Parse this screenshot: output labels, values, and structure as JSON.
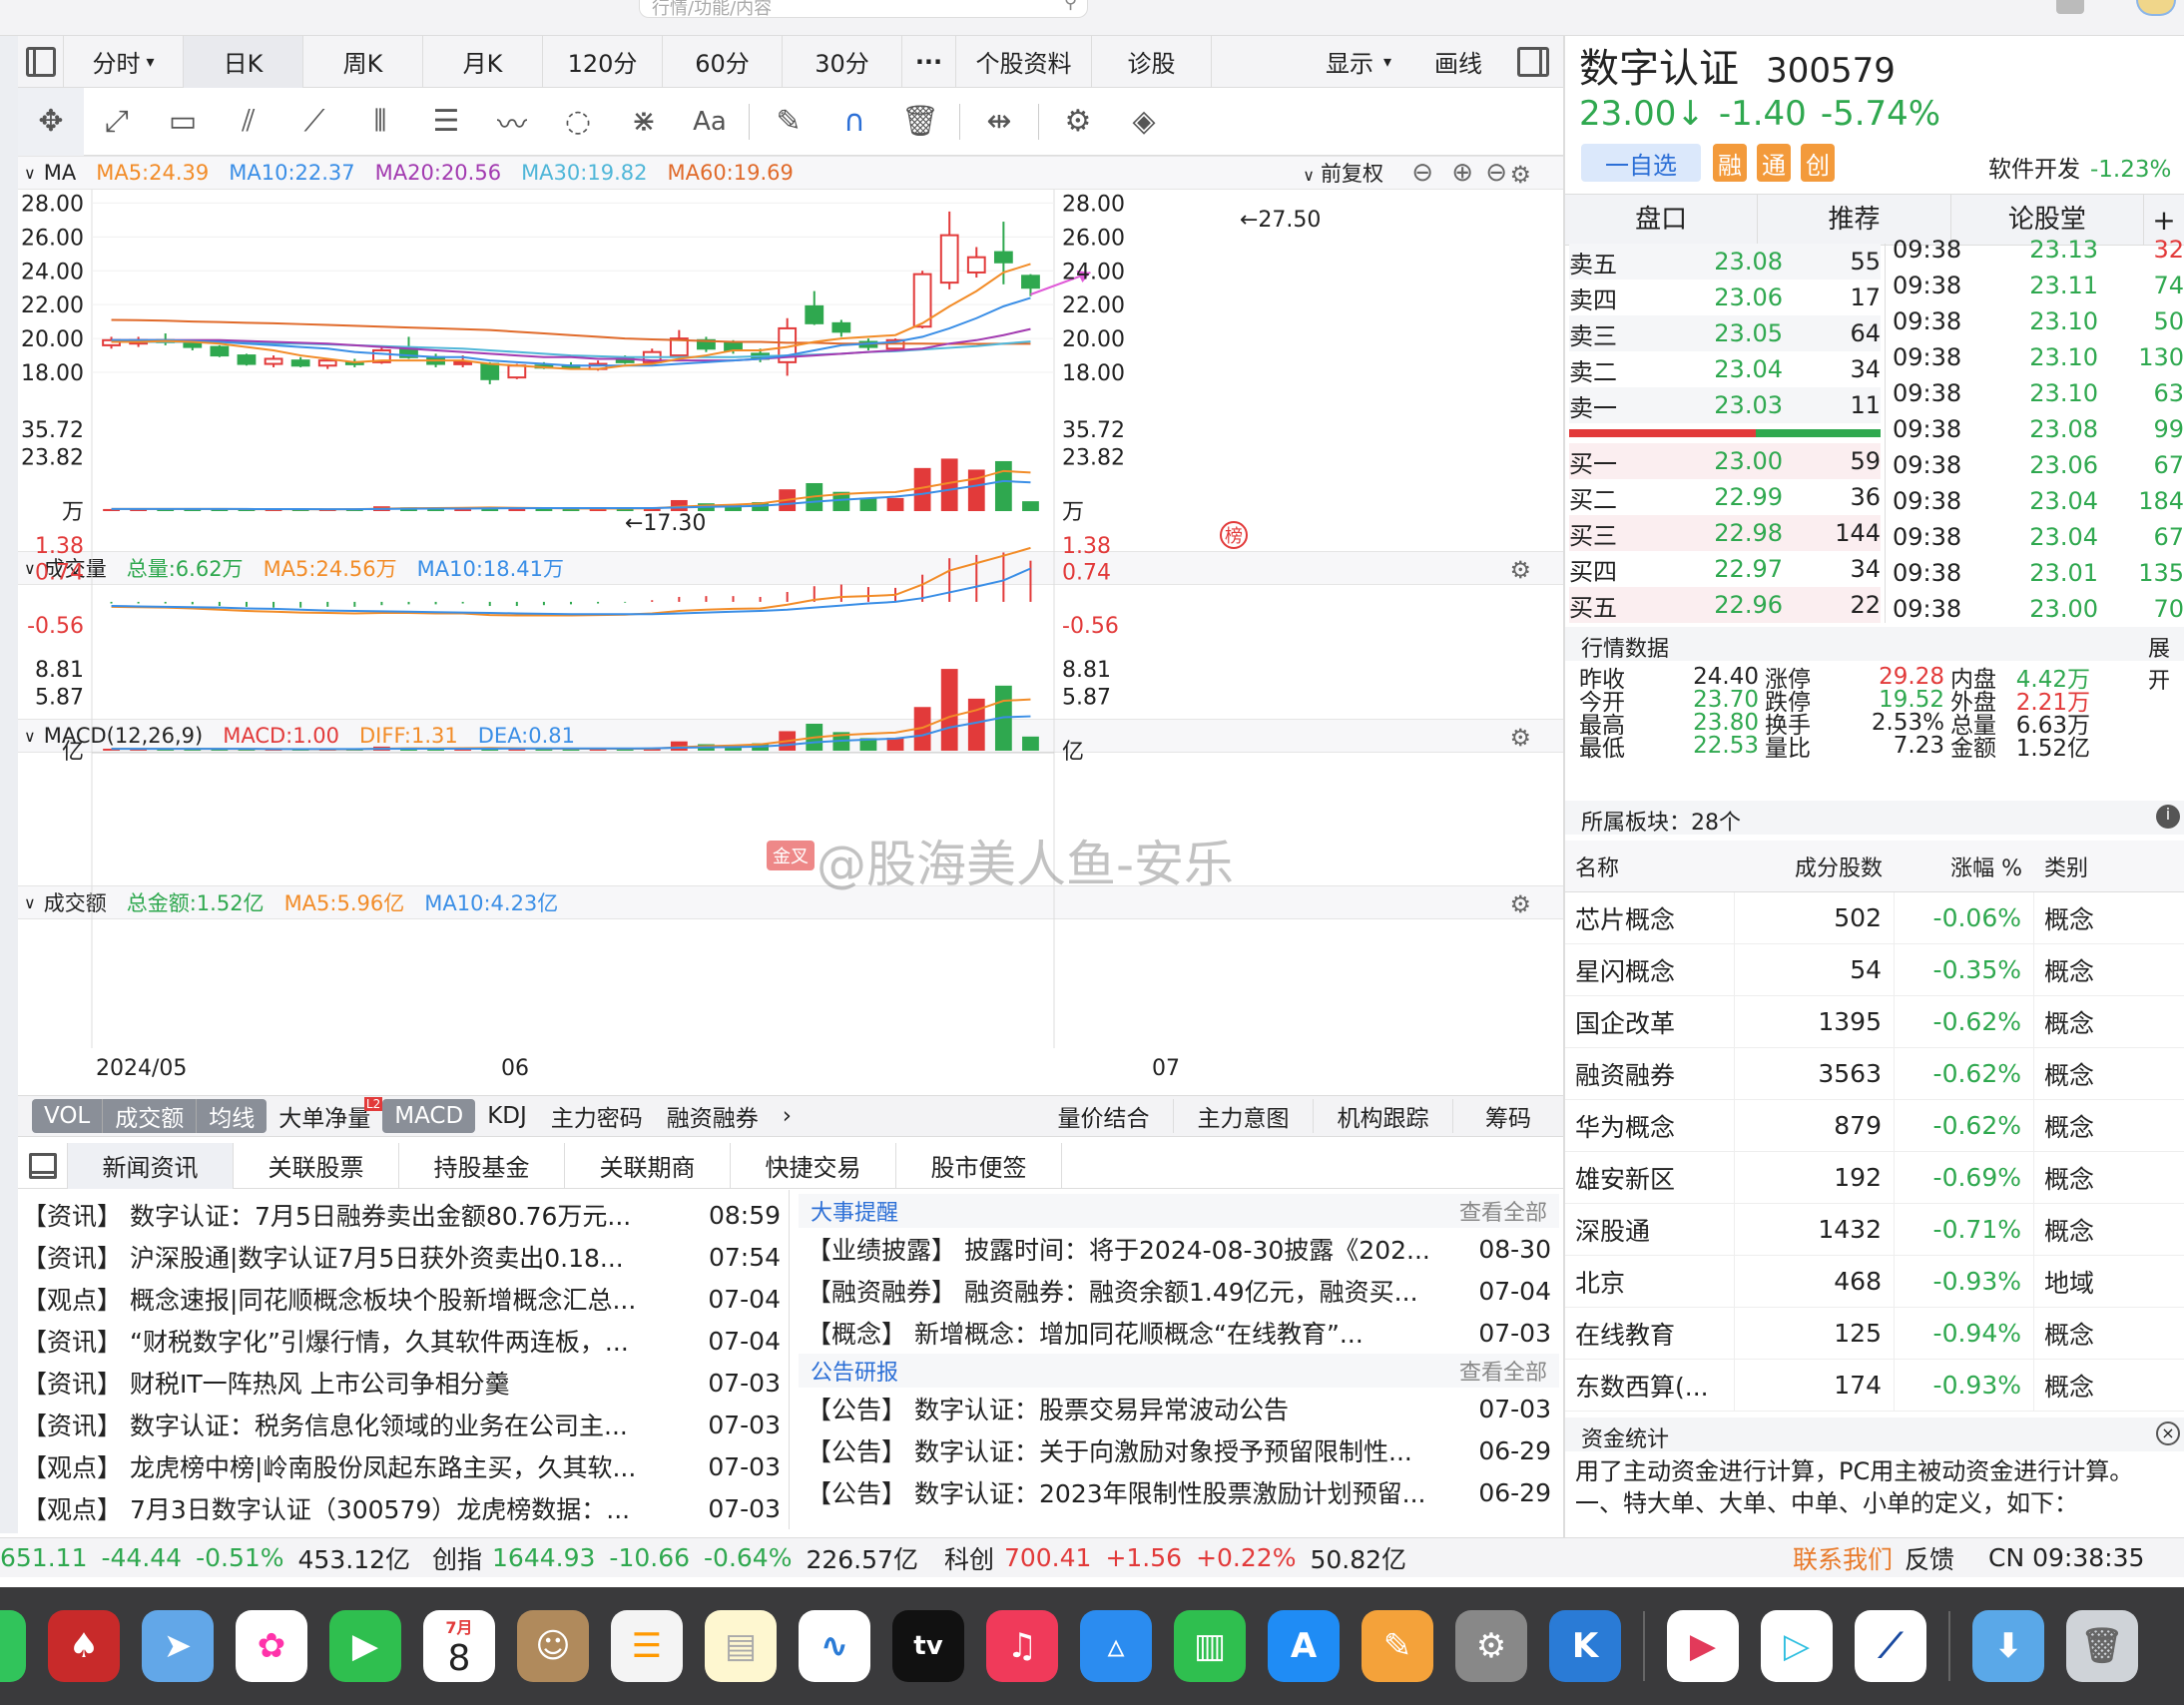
{
  "window": {
    "search_placeholder": "行情/功能/内容"
  },
  "period_tabs": [
    "分时",
    "日K",
    "周K",
    "月K",
    "120分",
    "60分",
    "30分",
    "···",
    "个股资料",
    "诊股"
  ],
  "period_active": 1,
  "header_right": {
    "display": "显示",
    "draw": "画线"
  },
  "ma_panel": {
    "title": "MA",
    "ma5": "MA5:24.39",
    "ma10": "MA10:22.37",
    "ma20": "MA20:20.56",
    "ma30": "MA30:19.82",
    "ma60": "MA60:19.69",
    "adjust": "前复权",
    "y_ticks": [
      "28.00",
      "26.00",
      "24.00",
      "22.00",
      "20.00",
      "18.00"
    ],
    "high_label": "←27.50",
    "low_label": "←17.30",
    "badge": "榜"
  },
  "vol_panel": {
    "title": "成交量",
    "total": "总量:6.62万",
    "ma5": "MA5:24.56万",
    "ma10": "MA10:18.41万",
    "y_ticks": [
      "35.72",
      "23.82",
      "万"
    ]
  },
  "macd_panel": {
    "title": "MACD(12,26,9)",
    "macd": "MACD:1.00",
    "diff": "DIFF:1.31",
    "dea": "DEA:0.81",
    "y_ticks": [
      "1.38",
      "0.74",
      "-0.56"
    ],
    "badge": "金叉"
  },
  "amt_panel": {
    "title": "成交额",
    "total": "总金额:1.52亿",
    "ma5": "MA5:5.96亿",
    "ma10": "MA10:4.23亿",
    "y_ticks": [
      "8.81",
      "5.87",
      "亿"
    ]
  },
  "x_labels": [
    "2024/05",
    "06",
    "07"
  ],
  "indicator_tabs": [
    "VOL",
    "成交额",
    "均线",
    "大单净量",
    "MACD",
    "KDJ",
    "主力密码",
    "融资融券"
  ],
  "indicator_l2": "L2",
  "indicator_right": [
    "量价结合",
    "主力意图",
    "机构跟踪",
    "筹码"
  ],
  "news_tabs": [
    "新闻资讯",
    "关联股票",
    "持股基金",
    "关联期商",
    "快捷交易",
    "股市便签"
  ],
  "news_items": [
    {
      "tag": "【资讯】",
      "title": "数字认证：7月5日融券卖出金额80.76万元...",
      "time": "08:59"
    },
    {
      "tag": "【资讯】",
      "title": "沪深股通|数字认证7月5日获外资卖出0.18...",
      "time": "07:54"
    },
    {
      "tag": "【观点】",
      "title": "概念速报|同花顺概念板块个股新增概念汇总...",
      "time": "07-04"
    },
    {
      "tag": "【资讯】",
      "title": "“财税数字化”引爆行情，久其软件两连板，...",
      "time": "07-04"
    },
    {
      "tag": "【资讯】",
      "title": "财税IT一阵热风 上市公司争相分羹",
      "time": "07-03"
    },
    {
      "tag": "【资讯】",
      "title": "数字认证：税务信息化领域的业务在公司主...",
      "time": "07-03"
    },
    {
      "tag": "【观点】",
      "title": "龙虎榜中榜|岭南股份凤起东路主买，久其软...",
      "time": "07-03"
    },
    {
      "tag": "【观点】",
      "title": "7月3日数字认证（300579）龙虎榜数据：...",
      "time": "07-03"
    }
  ],
  "events": {
    "title": "大事提醒",
    "more": "查看全部",
    "items": [
      {
        "tag": "【业绩披露】",
        "title": "披露时间：将于2024-08-30披露《202...",
        "time": "08-30"
      },
      {
        "tag": "【融资融券】",
        "title": "融资融券：融资余额1.49亿元，融资买...",
        "time": "07-04"
      },
      {
        "tag": "【概念】",
        "title": "新增概念：增加同花顺概念“在线教育”...",
        "time": "07-03"
      }
    ]
  },
  "notices": {
    "title": "公告研报",
    "more": "查看全部",
    "items": [
      {
        "tag": "【公告】",
        "title": "数字认证：股票交易异常波动公告",
        "time": "07-03"
      },
      {
        "tag": "【公告】",
        "title": "数字认证：关于向激励对象授予预留限制性...",
        "time": "06-29"
      },
      {
        "tag": "【公告】",
        "title": "数字认证：2023年限制性股票激励计划预留...",
        "time": "06-29"
      }
    ]
  },
  "stock": {
    "name": "数字认证",
    "code": "300579",
    "price": "23.00↓",
    "change": "-1.40",
    "pct": "-5.74%",
    "watch_btn": "一自选",
    "tags": [
      "融",
      "通",
      "创"
    ],
    "sector": "软件开发",
    "sector_pct": "-1.23%"
  },
  "right_tabs": [
    "盘口",
    "推荐",
    "论股堂"
  ],
  "sell_orders": [
    {
      "label": "卖五",
      "price": "23.08",
      "vol": "55"
    },
    {
      "label": "卖四",
      "price": "23.06",
      "vol": "17"
    },
    {
      "label": "卖三",
      "price": "23.05",
      "vol": "64"
    },
    {
      "label": "卖二",
      "price": "23.04",
      "vol": "34"
    },
    {
      "label": "卖一",
      "price": "23.03",
      "vol": "11"
    }
  ],
  "buy_orders": [
    {
      "label": "买一",
      "price": "23.00",
      "vol": "59"
    },
    {
      "label": "买二",
      "price": "22.99",
      "vol": "36"
    },
    {
      "label": "买三",
      "price": "22.98",
      "vol": "144"
    },
    {
      "label": "买四",
      "price": "22.97",
      "vol": "34"
    },
    {
      "label": "买五",
      "price": "22.96",
      "vol": "22"
    }
  ],
  "ticks": [
    {
      "t": "09:38",
      "p": "23.13",
      "v": "32",
      "c": "red"
    },
    {
      "t": "09:38",
      "p": "23.11",
      "v": "74",
      "c": "green"
    },
    {
      "t": "09:38",
      "p": "23.10",
      "v": "50",
      "c": "green"
    },
    {
      "t": "09:38",
      "p": "23.10",
      "v": "130",
      "c": "green"
    },
    {
      "t": "09:38",
      "p": "23.10",
      "v": "63",
      "c": "green"
    },
    {
      "t": "09:38",
      "p": "23.08",
      "v": "99",
      "c": "green"
    },
    {
      "t": "09:38",
      "p": "23.06",
      "v": "67",
      "c": "green"
    },
    {
      "t": "09:38",
      "p": "23.04",
      "v": "184",
      "c": "green"
    },
    {
      "t": "09:38",
      "p": "23.04",
      "v": "67",
      "c": "green"
    },
    {
      "t": "09:38",
      "p": "23.01",
      "v": "135",
      "c": "green"
    },
    {
      "t": "09:38",
      "p": "23.00",
      "v": "70",
      "c": "green"
    }
  ],
  "market_data": {
    "title": "行情数据",
    "expand": "展开",
    "rows": [
      [
        {
          "k": "昨收",
          "v": "24.40",
          "c": ""
        },
        {
          "k": "涨停",
          "v": "29.28",
          "c": "red"
        },
        {
          "k": "内盘",
          "v": "4.42万",
          "c": "green"
        }
      ],
      [
        {
          "k": "今开",
          "v": "23.70",
          "c": "green"
        },
        {
          "k": "跌停",
          "v": "19.52",
          "c": "green"
        },
        {
          "k": "外盘",
          "v": "2.21万",
          "c": "red"
        }
      ],
      [
        {
          "k": "最高",
          "v": "23.80",
          "c": "green"
        },
        {
          "k": "换手",
          "v": "2.53%",
          "c": ""
        },
        {
          "k": "总量",
          "v": "6.63万",
          "c": ""
        }
      ],
      [
        {
          "k": "最低",
          "v": "22.53",
          "c": "green"
        },
        {
          "k": "量比",
          "v": "7.23",
          "c": ""
        },
        {
          "k": "金额",
          "v": "1.52亿",
          "c": ""
        }
      ]
    ]
  },
  "sectors": {
    "title": "所属板块：28个",
    "headers": [
      "名称",
      "成分股数",
      "涨幅 %",
      "类别"
    ],
    "rows": [
      {
        "name": "芯片概念",
        "n": "502",
        "pct": "-0.06%",
        "type": "概念"
      },
      {
        "name": "星闪概念",
        "n": "54",
        "pct": "-0.35%",
        "type": "概念"
      },
      {
        "name": "国企改革",
        "n": "1395",
        "pct": "-0.62%",
        "type": "概念"
      },
      {
        "name": "融资融券",
        "n": "3563",
        "pct": "-0.62%",
        "type": "概念"
      },
      {
        "name": "华为概念",
        "n": "879",
        "pct": "-0.62%",
        "type": "概念"
      },
      {
        "name": "雄安新区",
        "n": "192",
        "pct": "-0.69%",
        "type": "概念"
      },
      {
        "name": "深股通",
        "n": "1432",
        "pct": "-0.71%",
        "type": "概念"
      },
      {
        "name": "北京",
        "n": "468",
        "pct": "-0.93%",
        "type": "地域"
      },
      {
        "name": "在线教育",
        "n": "125",
        "pct": "-0.94%",
        "type": "概念"
      },
      {
        "name": "东数西算(...",
        "n": "174",
        "pct": "-0.93%",
        "type": "概念"
      }
    ]
  },
  "fund_stats": {
    "title": "资金统计",
    "line1": "用了主动资金进行计算，PC用主被动资金进行计算。",
    "line2": "一、特大单、大单、中单、小单的定义，如下："
  },
  "status": {
    "idx1_val": "651.11",
    "idx1_chg": "-44.44",
    "idx1_pct": "-0.51%",
    "idx1_amt": "453.12亿",
    "idx2_name": "创指",
    "idx2_val": "1644.93",
    "idx2_chg": "-10.66",
    "idx2_pct": "-0.64%",
    "idx2_amt": "226.57亿",
    "idx3_name": "科创",
    "idx3_val": "700.41",
    "idx3_chg": "+1.56",
    "idx3_pct": "+0.22%",
    "idx3_amt": "50.82亿",
    "contact": "联系我们",
    "feedback": "反馈",
    "clock": "CN 09:38:35"
  },
  "watermark": "@股海美人鱼-安乐",
  "dock_calendar": {
    "month": "7月",
    "day": "8"
  },
  "colors": {
    "up": "#e23a3a",
    "down": "#2fa84f",
    "ma5": "#f28c28",
    "ma10": "#3a8ee6",
    "ma20": "#a23ab0",
    "ma30": "#4fb6d8",
    "ma60": "#e06a2a"
  },
  "chart_data": {
    "type": "candlestick",
    "ylim": [
      17.0,
      28.2
    ],
    "candles": [
      {
        "o": 19.6,
        "c": 19.9,
        "h": 20.1,
        "l": 19.4
      },
      {
        "o": 19.7,
        "c": 19.9,
        "h": 20.1,
        "l": 19.5
      },
      {
        "o": 19.9,
        "c": 19.8,
        "h": 20.3,
        "l": 19.6
      },
      {
        "o": 19.8,
        "c": 19.5,
        "h": 19.9,
        "l": 19.3
      },
      {
        "o": 19.5,
        "c": 19.0,
        "h": 19.6,
        "l": 18.9
      },
      {
        "o": 19.0,
        "c": 18.5,
        "h": 19.1,
        "l": 18.4
      },
      {
        "o": 18.5,
        "c": 18.8,
        "h": 19.0,
        "l": 18.3
      },
      {
        "o": 18.7,
        "c": 18.4,
        "h": 18.9,
        "l": 18.3
      },
      {
        "o": 18.4,
        "c": 18.7,
        "h": 18.8,
        "l": 18.2
      },
      {
        "o": 18.6,
        "c": 18.5,
        "h": 18.8,
        "l": 18.3
      },
      {
        "o": 18.6,
        "c": 19.3,
        "h": 19.5,
        "l": 18.5
      },
      {
        "o": 19.4,
        "c": 18.9,
        "h": 20.1,
        "l": 18.8
      },
      {
        "o": 18.9,
        "c": 18.5,
        "h": 19.1,
        "l": 18.3
      },
      {
        "o": 18.5,
        "c": 18.6,
        "h": 19.0,
        "l": 18.3
      },
      {
        "o": 18.5,
        "c": 17.6,
        "h": 18.6,
        "l": 17.3
      },
      {
        "o": 17.7,
        "c": 18.4,
        "h": 18.5,
        "l": 17.6
      },
      {
        "o": 18.4,
        "c": 18.3,
        "h": 18.6,
        "l": 18.2
      },
      {
        "o": 18.4,
        "c": 18.3,
        "h": 18.6,
        "l": 18.2
      },
      {
        "o": 18.2,
        "c": 18.5,
        "h": 18.7,
        "l": 18.1
      },
      {
        "o": 18.8,
        "c": 18.6,
        "h": 19.0,
        "l": 18.5
      },
      {
        "o": 18.6,
        "c": 19.2,
        "h": 19.4,
        "l": 18.5
      },
      {
        "o": 19.0,
        "c": 20.0,
        "h": 20.5,
        "l": 18.9
      },
      {
        "o": 19.9,
        "c": 19.4,
        "h": 20.1,
        "l": 19.2
      },
      {
        "o": 19.8,
        "c": 19.3,
        "h": 19.9,
        "l": 19.1
      },
      {
        "o": 19.1,
        "c": 18.8,
        "h": 19.4,
        "l": 18.6
      },
      {
        "o": 18.6,
        "c": 20.6,
        "h": 21.2,
        "l": 17.8
      },
      {
        "o": 21.9,
        "c": 20.9,
        "h": 22.8,
        "l": 20.8
      },
      {
        "o": 20.9,
        "c": 20.4,
        "h": 21.1,
        "l": 20.1
      },
      {
        "o": 19.8,
        "c": 19.5,
        "h": 20.0,
        "l": 19.3
      },
      {
        "o": 19.4,
        "c": 19.9,
        "h": 20.0,
        "l": 19.3
      },
      {
        "o": 20.7,
        "c": 23.8,
        "h": 24.0,
        "l": 20.6
      },
      {
        "o": 23.3,
        "c": 26.1,
        "h": 27.5,
        "l": 22.9
      },
      {
        "o": 23.9,
        "c": 24.8,
        "h": 25.4,
        "l": 23.6
      },
      {
        "o": 25.1,
        "c": 24.5,
        "h": 26.9,
        "l": 23.2
      },
      {
        "o": 23.7,
        "c": 23.0,
        "h": 23.8,
        "l": 22.5
      }
    ],
    "volume": [
      0.9,
      1.1,
      0.8,
      0.9,
      0.8,
      0.7,
      0.7,
      0.9,
      0.7,
      0.8,
      2.1,
      1.6,
      1.2,
      1.0,
      1.4,
      1.2,
      1.0,
      0.9,
      1.1,
      1.2,
      1.4,
      4.8,
      3.4,
      2.9,
      3.9,
      9.5,
      12.2,
      8.4,
      5.8,
      5.7,
      18.8,
      22.9,
      18.1,
      21.8,
      4.3
    ],
    "vol_ma5": [
      0.9,
      0.95,
      0.9,
      0.9,
      0.9,
      0.85,
      0.8,
      0.8,
      0.75,
      0.8,
      1.05,
      1.25,
      1.3,
      1.4,
      1.6,
      1.4,
      1.3,
      1.15,
      1.1,
      1.1,
      1.2,
      1.9,
      2.4,
      2.8,
      3.3,
      4.9,
      6.4,
      7.4,
      8.0,
      8.3,
      10.2,
      12.3,
      14.2,
      17.5,
      16.8
    ],
    "vol_ma10": [
      0.9,
      0.9,
      0.9,
      0.9,
      0.9,
      0.9,
      0.85,
      0.85,
      0.8,
      0.8,
      0.95,
      1.05,
      1.1,
      1.1,
      1.2,
      1.25,
      1.3,
      1.3,
      1.3,
      1.3,
      1.3,
      1.6,
      1.85,
      2.0,
      2.3,
      3.1,
      4.1,
      4.9,
      5.6,
      6.3,
      7.5,
      9.3,
      11.1,
      13.1,
      12.5
    ],
    "macd": {
      "diff": [
        -0.12,
        -0.13,
        -0.14,
        -0.16,
        -0.19,
        -0.22,
        -0.24,
        -0.26,
        -0.27,
        -0.28,
        -0.27,
        -0.27,
        -0.28,
        -0.28,
        -0.32,
        -0.33,
        -0.33,
        -0.33,
        -0.32,
        -0.31,
        -0.28,
        -0.22,
        -0.19,
        -0.17,
        -0.16,
        -0.07,
        0.05,
        0.12,
        0.14,
        0.17,
        0.42,
        0.76,
        0.94,
        1.12,
        1.31
      ],
      "dea": [
        -0.1,
        -0.11,
        -0.12,
        -0.13,
        -0.14,
        -0.16,
        -0.17,
        -0.19,
        -0.21,
        -0.22,
        -0.23,
        -0.24,
        -0.25,
        -0.26,
        -0.27,
        -0.28,
        -0.29,
        -0.3,
        -0.3,
        -0.3,
        -0.3,
        -0.28,
        -0.26,
        -0.24,
        -0.22,
        -0.19,
        -0.14,
        -0.09,
        -0.04,
        0.0,
        0.09,
        0.23,
        0.37,
        0.52,
        0.81
      ],
      "hist": [
        -0.04,
        -0.04,
        -0.04,
        -0.06,
        -0.1,
        -0.12,
        -0.14,
        -0.14,
        -0.12,
        -0.12,
        -0.08,
        -0.06,
        -0.06,
        -0.04,
        -0.1,
        -0.1,
        -0.08,
        -0.06,
        -0.04,
        -0.02,
        0.04,
        0.12,
        0.14,
        0.14,
        0.12,
        0.24,
        0.38,
        0.42,
        0.36,
        0.34,
        0.66,
        1.06,
        1.14,
        1.2,
        1.0
      ]
    },
    "amount": [
      0.21,
      0.24,
      0.18,
      0.19,
      0.17,
      0.14,
      0.14,
      0.18,
      0.14,
      0.16,
      0.44,
      0.33,
      0.24,
      0.2,
      0.27,
      0.23,
      0.2,
      0.18,
      0.22,
      0.24,
      0.28,
      1.0,
      0.7,
      0.6,
      0.8,
      2.1,
      2.9,
      2.0,
      1.35,
      1.4,
      4.7,
      8.8,
      5.6,
      7.0,
      1.52
    ],
    "amt_ma5": [
      0.2,
      0.2,
      0.2,
      0.2,
      0.2,
      0.19,
      0.17,
      0.16,
      0.15,
      0.15,
      0.21,
      0.25,
      0.26,
      0.27,
      0.3,
      0.26,
      0.23,
      0.22,
      0.22,
      0.21,
      0.22,
      0.38,
      0.49,
      0.57,
      0.68,
      1.04,
      1.42,
      1.68,
      1.83,
      1.95,
      2.47,
      3.65,
      4.37,
      5.37,
      5.52
    ],
    "amt_ma10": [
      0.2,
      0.2,
      0.2,
      0.2,
      0.2,
      0.2,
      0.18,
      0.18,
      0.17,
      0.17,
      0.2,
      0.22,
      0.21,
      0.21,
      0.22,
      0.23,
      0.24,
      0.24,
      0.24,
      0.24,
      0.25,
      0.32,
      0.36,
      0.39,
      0.44,
      0.62,
      0.9,
      1.08,
      1.2,
      1.3,
      1.65,
      2.5,
      3.02,
      3.6,
      3.7
    ],
    "ma5": [
      19.8,
      19.8,
      19.85,
      19.8,
      19.7,
      19.5,
      19.3,
      19.0,
      18.8,
      18.6,
      18.7,
      18.7,
      18.7,
      18.7,
      18.5,
      18.4,
      18.3,
      18.2,
      18.2,
      18.4,
      18.5,
      18.8,
      19.0,
      19.3,
      19.3,
      19.5,
      19.8,
      20.0,
      20.1,
      20.2,
      20.9,
      21.9,
      22.8,
      23.9,
      24.4
    ],
    "ma10": [
      19.9,
      19.9,
      19.9,
      19.85,
      19.8,
      19.7,
      19.6,
      19.5,
      19.4,
      19.2,
      19.1,
      19.0,
      18.9,
      18.9,
      18.7,
      18.6,
      18.5,
      18.4,
      18.4,
      18.4,
      18.4,
      18.5,
      18.6,
      18.7,
      18.8,
      19.0,
      19.3,
      19.6,
      19.7,
      19.8,
      20.1,
      20.6,
      21.2,
      21.9,
      22.4
    ],
    "ma20": [
      19.9,
      19.9,
      19.9,
      19.9,
      19.9,
      19.85,
      19.8,
      19.75,
      19.7,
      19.6,
      19.5,
      19.4,
      19.3,
      19.2,
      19.1,
      19.0,
      18.9,
      18.9,
      18.8,
      18.8,
      18.7,
      18.7,
      18.7,
      18.7,
      18.8,
      18.9,
      19.0,
      19.1,
      19.2,
      19.3,
      19.4,
      19.7,
      19.9,
      20.2,
      20.56
    ],
    "ma30": [
      19.8,
      19.8,
      19.8,
      19.8,
      19.8,
      19.75,
      19.7,
      19.7,
      19.65,
      19.6,
      19.55,
      19.5,
      19.45,
      19.4,
      19.3,
      19.2,
      19.1,
      19.0,
      18.95,
      18.9,
      18.9,
      18.9,
      18.9,
      18.9,
      18.95,
      19.0,
      19.05,
      19.1,
      19.2,
      19.25,
      19.35,
      19.45,
      19.55,
      19.7,
      19.82
    ],
    "ma60": [
      21.1,
      21.08,
      21.05,
      21.0,
      20.97,
      20.93,
      20.9,
      20.85,
      20.8,
      20.75,
      20.7,
      20.65,
      20.6,
      20.55,
      20.5,
      20.4,
      20.3,
      20.2,
      20.1,
      20.0,
      19.95,
      19.9,
      19.85,
      19.8,
      19.8,
      19.75,
      19.75,
      19.7,
      19.7,
      19.7,
      19.7,
      19.68,
      19.68,
      19.69,
      19.69
    ]
  }
}
